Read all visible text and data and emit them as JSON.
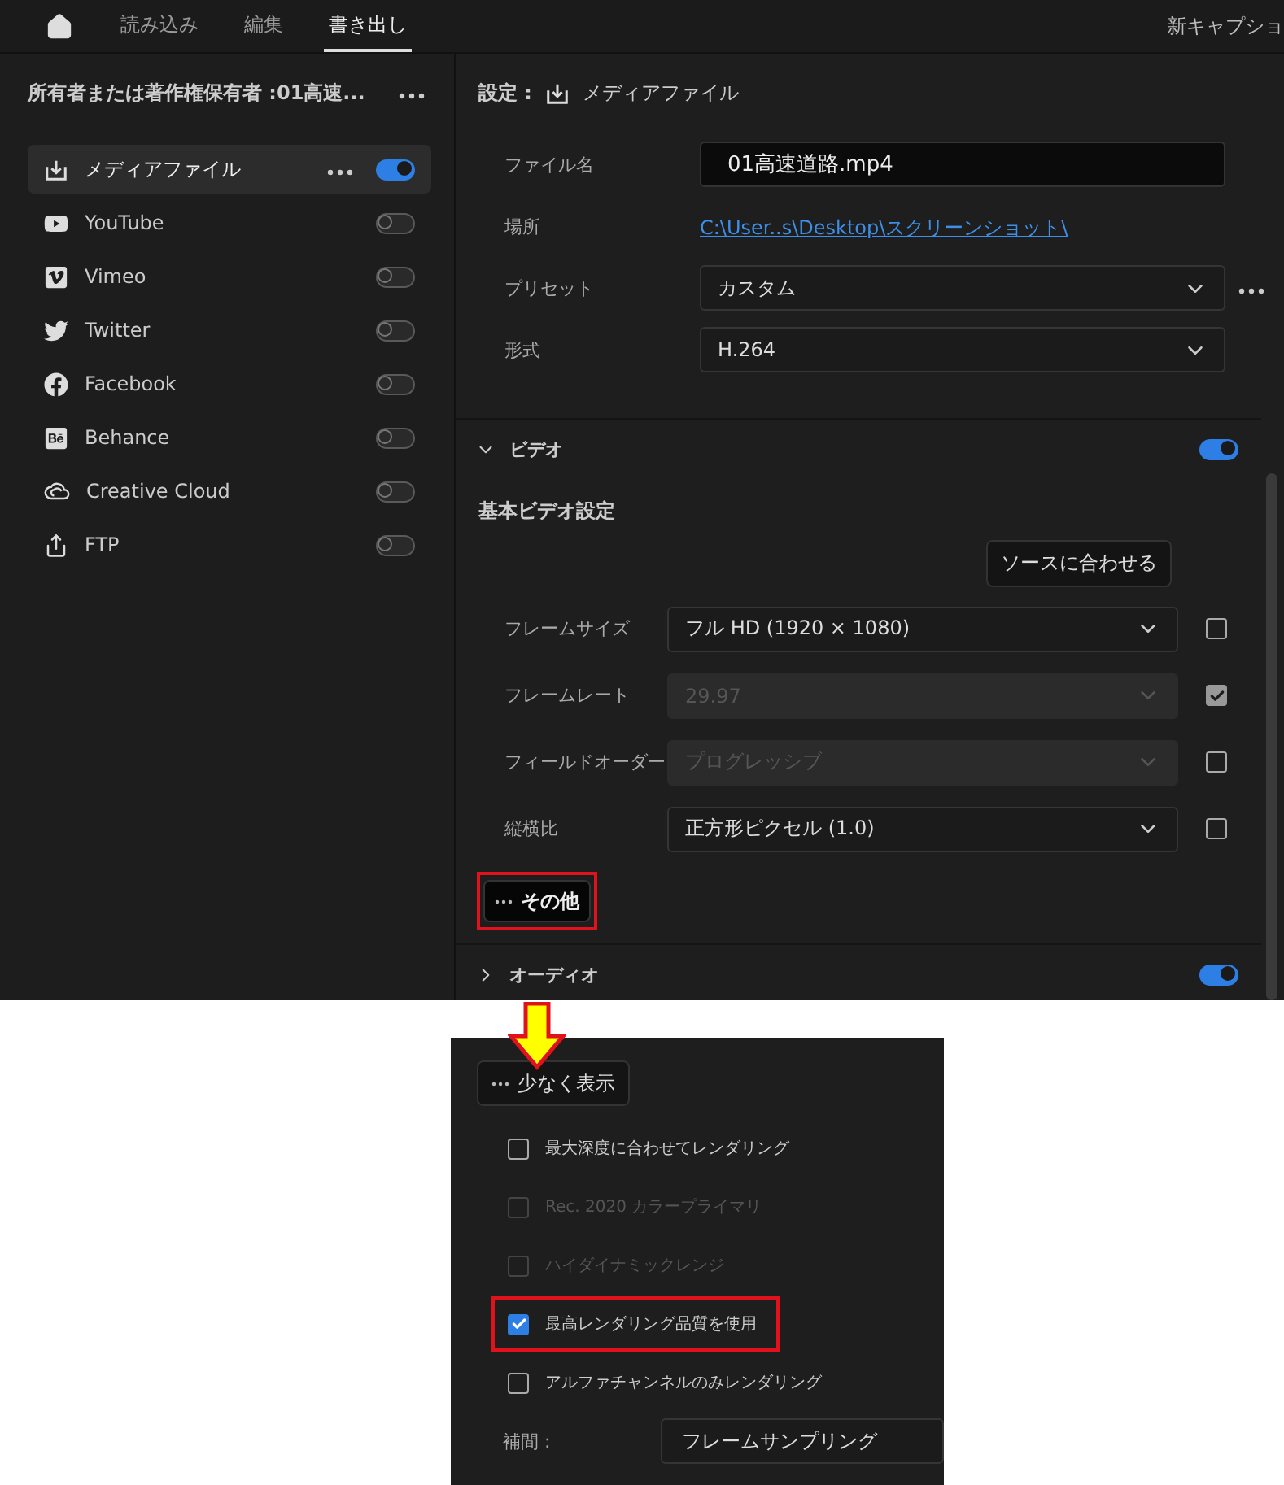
{
  "topbar": {
    "tabs": [
      {
        "label": "読み込み",
        "selected": false
      },
      {
        "label": "編集",
        "selected": false
      },
      {
        "label": "書き出し",
        "selected": true
      }
    ],
    "right_text": "新キャプショ"
  },
  "sidebar": {
    "title": "所有者または著作権保有者 :01高速...",
    "items": [
      {
        "label": "メディアファイル",
        "selected": true,
        "on": true,
        "menu": true
      },
      {
        "label": "YouTube",
        "selected": false,
        "on": false,
        "menu": false
      },
      {
        "label": "Vimeo",
        "selected": false,
        "on": false,
        "menu": false
      },
      {
        "label": "Twitter",
        "selected": false,
        "on": false,
        "menu": false
      },
      {
        "label": "Facebook",
        "selected": false,
        "on": false,
        "menu": false
      },
      {
        "label": "Behance",
        "selected": false,
        "on": false,
        "menu": false
      },
      {
        "label": "Creative Cloud",
        "selected": false,
        "on": false,
        "menu": false
      },
      {
        "label": "FTP",
        "selected": false,
        "on": false,
        "menu": false
      }
    ]
  },
  "settings": {
    "heading": "設定 :",
    "target": "メディアファイル",
    "fields": [
      {
        "kind": "input",
        "label": "ファイル名",
        "value": "01高速道路.mp4",
        "menu": false
      },
      {
        "kind": "link",
        "label": "場所",
        "value": "C:\\User..s\\Desktop\\スクリーンショット\\",
        "menu": false
      },
      {
        "kind": "select",
        "label": "プリセット",
        "value": "カスタム",
        "menu": true
      },
      {
        "kind": "select",
        "label": "形式",
        "value": "H.264",
        "menu": false
      }
    ]
  },
  "video": {
    "title": "ビデオ",
    "expanded": true,
    "on": true,
    "subheading": "基本ビデオ設定",
    "match_button": "ソースに合わせる",
    "rows": [
      {
        "label": "フレームサイズ",
        "value": "フル HD (1920 × 1080)",
        "disabled": false,
        "checked": false
      },
      {
        "label": "フレームレート",
        "value": "29.97",
        "disabled": true,
        "checked": true
      },
      {
        "label": "フィールドオーダー",
        "value": "プログレッシブ",
        "disabled": true,
        "checked": false
      },
      {
        "label": "縦横比",
        "value": "正方形ピクセル (1.0)",
        "disabled": false,
        "checked": false
      }
    ],
    "more_button": "その他"
  },
  "audio": {
    "title": "オーディオ",
    "expanded": false,
    "on": true
  },
  "inset": {
    "less_button": "少なく表示",
    "options": [
      {
        "label": "最大深度に合わせてレンダリング",
        "checked": false,
        "disabled": false,
        "highlighted": false
      },
      {
        "label": "Rec. 2020 カラープライマリ",
        "checked": false,
        "disabled": true,
        "highlighted": false
      },
      {
        "label": "ハイダイナミックレンジ",
        "checked": false,
        "disabled": true,
        "highlighted": false
      },
      {
        "label": "最高レンダリング品質を使用",
        "checked": true,
        "disabled": false,
        "highlighted": true
      },
      {
        "label": "アルファチャンネルのみレンダリング",
        "checked": false,
        "disabled": false,
        "highlighted": false
      }
    ],
    "interpolation": {
      "label": "補間 :",
      "value": "フレームサンプリング"
    }
  }
}
